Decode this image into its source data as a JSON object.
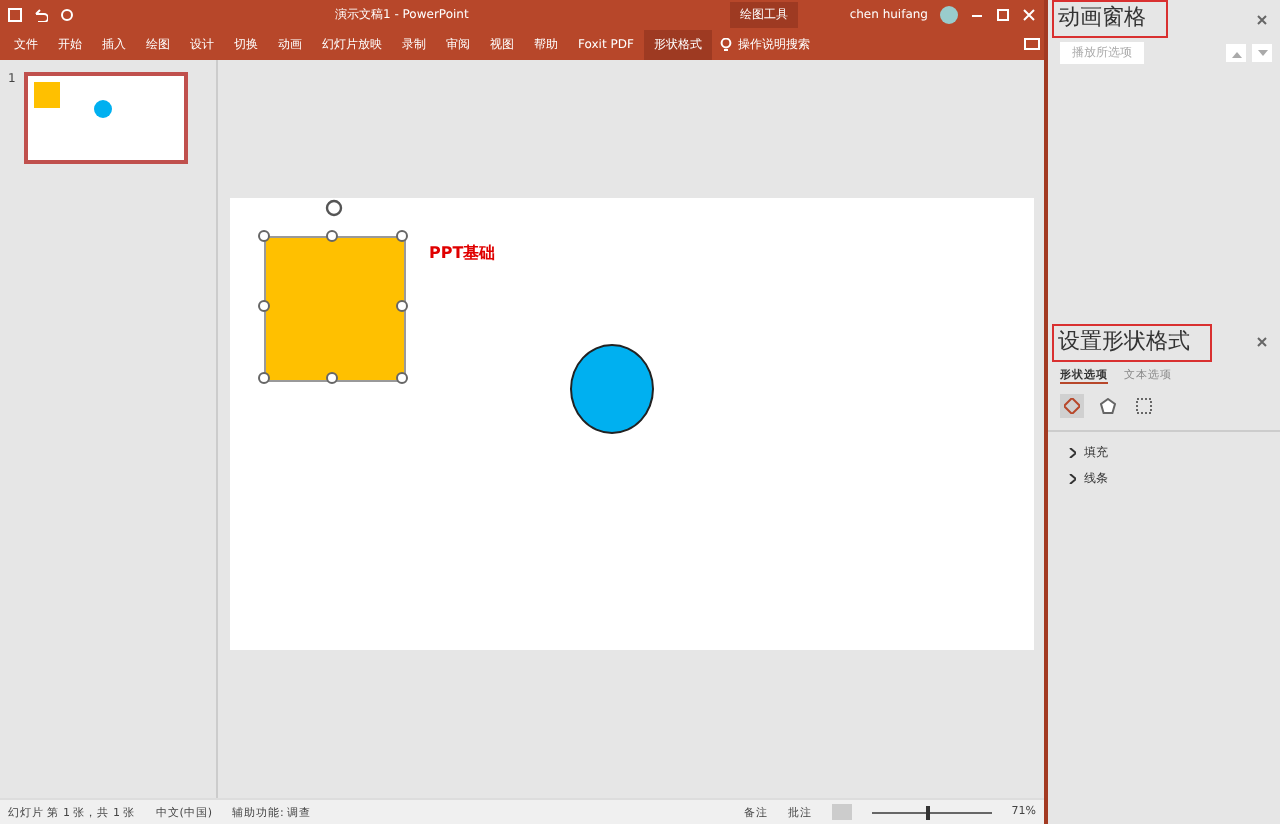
{
  "window": {
    "title": "演示文稿1 - PowerPoint",
    "context_label": "绘图工具",
    "user": "chen huifang"
  },
  "ribbon_tabs": [
    {
      "label": "文件",
      "selected": false
    },
    {
      "label": "开始",
      "selected": false
    },
    {
      "label": "插入",
      "selected": false
    },
    {
      "label": "绘图",
      "selected": false
    },
    {
      "label": "设计",
      "selected": false
    },
    {
      "label": "切换",
      "selected": false
    },
    {
      "label": "动画",
      "selected": false
    },
    {
      "label": "幻灯片放映",
      "selected": false
    },
    {
      "label": "录制",
      "selected": false
    },
    {
      "label": "审阅",
      "selected": false
    },
    {
      "label": "视图",
      "selected": false
    },
    {
      "label": "帮助",
      "selected": false
    },
    {
      "label": "Foxit PDF",
      "selected": false
    },
    {
      "label": "形状格式",
      "selected": true
    }
  ],
  "search": {
    "placeholder": "操作说明搜索"
  },
  "thumbnails": [
    {
      "number": "1",
      "selected": true
    }
  ],
  "slide": {
    "text": "PPT基础"
  },
  "animation_pane": {
    "title": "动画窗格",
    "play_button": "播放所选项"
  },
  "format_pane": {
    "title": "设置形状格式",
    "tabs": [
      {
        "label": "形状选项",
        "selected": true
      },
      {
        "label": "文本选项",
        "selected": false
      }
    ],
    "sections": [
      {
        "label": "填充",
        "expanded": false
      },
      {
        "label": "线条",
        "expanded": false
      }
    ]
  },
  "status_bar": {
    "slide_info": "幻灯片 第 1 张，共 1 张",
    "language": "中文(中国)",
    "accessibility": "辅助功能: 调查",
    "notes": "备注",
    "comments": "批注",
    "zoom": "71%",
    "zoom_slider": {
      "level": 0.45
    }
  }
}
